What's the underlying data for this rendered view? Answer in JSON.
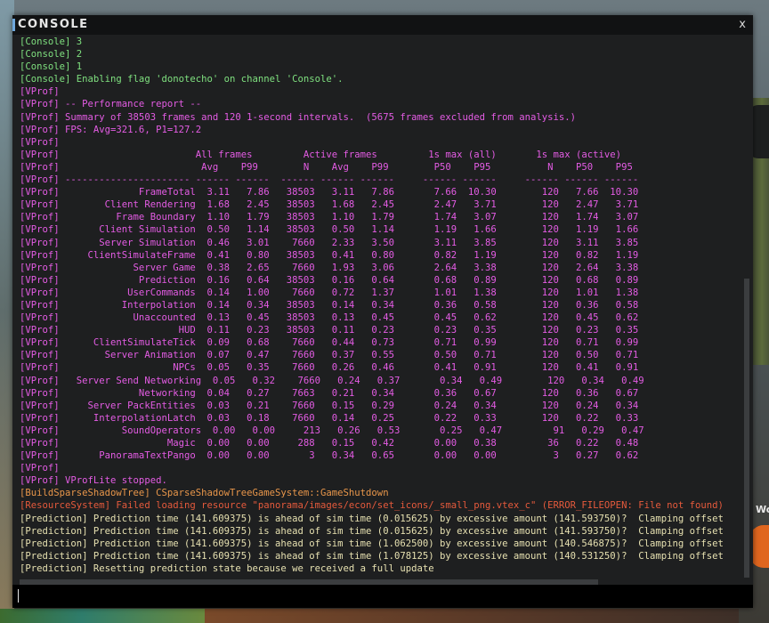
{
  "window": {
    "title": "CONSOLE",
    "close_label": "x"
  },
  "input": {
    "value": "",
    "placeholder": ""
  },
  "background": {
    "side_text": "Wo"
  },
  "colors": {
    "console": "#7fe07f",
    "vprof": "#e45ce4",
    "build": "#e8964a",
    "resource": "#e65a3c",
    "prediction": "#e6e0b0"
  },
  "lines": [
    "[Console] 3",
    "[Console] 2",
    "[Console] 1",
    "[Console] Enabling flag 'donotecho' on channel 'Console'.",
    "[VProf]",
    "[VProf] -- Performance report --",
    "[VProf] Summary of 38503 frames and 120 1-second intervals.  (5675 frames excluded from analysis.)",
    "[VProf] FPS: Avg=321.6, P1=127.2",
    "[VProf]",
    "[VProf]                        All frames         Active frames         1s max (all)       1s max (active)",
    "[VProf]                         Avg    P99        N    Avg    P99        P50    P95          N    P50    P95",
    "[VProf] ---------------------- ------ ------  ------ ------ ------     ------ ------     ------ ------ ------",
    "[VProf]              FrameTotal  3.11   7.86   38503   3.11   7.86       7.66  10.30        120   7.66  10.30",
    "[VProf]        Client Rendering  1.68   2.45   38503   1.68   2.45       2.47   3.71        120   2.47   3.71",
    "[VProf]          Frame Boundary  1.10   1.79   38503   1.10   1.79       1.74   3.07        120   1.74   3.07",
    "[VProf]       Client Simulation  0.50   1.14   38503   0.50   1.14       1.19   1.66        120   1.19   1.66",
    "[VProf]       Server Simulation  0.46   3.01    7660   2.33   3.50       3.11   3.85        120   3.11   3.85",
    "[VProf]     ClientSimulateFrame  0.41   0.80   38503   0.41   0.80       0.82   1.19        120   0.82   1.19",
    "[VProf]             Server Game  0.38   2.65    7660   1.93   3.06       2.64   3.38        120   2.64   3.38",
    "[VProf]              Prediction  0.16   0.64   38503   0.16   0.64       0.68   0.89        120   0.68   0.89",
    "[VProf]            UserCommands  0.14   1.00    7660   0.72   1.37       1.01   1.38        120   1.01   1.38",
    "[VProf]           Interpolation  0.14   0.34   38503   0.14   0.34       0.36   0.58        120   0.36   0.58",
    "[VProf]             Unaccounted  0.13   0.45   38503   0.13   0.45       0.45   0.62        120   0.45   0.62",
    "[VProf]                     HUD  0.11   0.23   38503   0.11   0.23       0.23   0.35        120   0.23   0.35",
    "[VProf]      ClientSimulateTick  0.09   0.68    7660   0.44   0.73       0.71   0.99        120   0.71   0.99",
    "[VProf]        Server Animation  0.07   0.47    7660   0.37   0.55       0.50   0.71        120   0.50   0.71",
    "[VProf]                    NPCs  0.05   0.35    7660   0.26   0.46       0.41   0.91        120   0.41   0.91",
    "[VProf]   Server Send Networking  0.05   0.32    7660   0.24   0.37       0.34   0.49        120   0.34   0.49",
    "[VProf]              Networking  0.04   0.27    7663   0.21   0.34       0.36   0.67        120   0.36   0.67",
    "[VProf]     Server PackEntities  0.03   0.21    7660   0.15   0.29       0.24   0.34        120   0.24   0.34",
    "[VProf]      InterpolationLatch  0.03   0.18    7660   0.14   0.25       0.22   0.33        120   0.22   0.33",
    "[VProf]           SoundOperators  0.00   0.00     213   0.26   0.53       0.25   0.47         91   0.29   0.47",
    "[VProf]                   Magic  0.00   0.00     288   0.15   0.42       0.00   0.38         36   0.22   0.48",
    "[VProf]       PanoramaTextPango  0.00   0.00       3   0.34   0.65       0.00   0.00          3   0.27   0.62",
    "[VProf]",
    "[VProf] VProfLite stopped.",
    "[BuildSparseShadowTree] CSparseShadowTreeGameSystem::GameShutdown",
    "[ResourceSystem] Failed loading resource \"panorama/images/econ/set_icons/_small_png.vtex_c\" (ERROR_FILEOPEN: File not found)",
    "[Prediction] Prediction time (141.609375) is ahead of sim time (0.015625) by excessive amount (141.593750)?  Clamping offset",
    "[Prediction] Prediction time (141.609375) is ahead of sim time (0.015625) by excessive amount (141.593750)?  Clamping offset",
    "[Prediction] Prediction time (141.609375) is ahead of sim time (1.062500) by excessive amount (140.546875)?  Clamping offset",
    "[Prediction] Prediction time (141.609375) is ahead of sim time (1.078125) by excessive amount (140.531250)?  Clamping offset",
    "[Prediction] Resetting prediction state because we received a full update"
  ]
}
